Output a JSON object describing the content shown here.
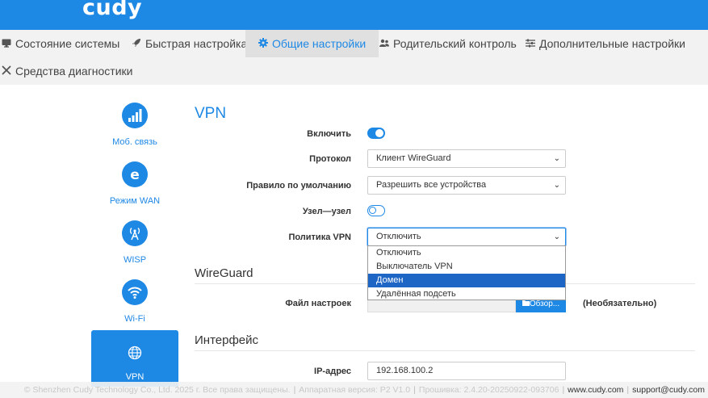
{
  "brand": {
    "logo": "cudy"
  },
  "nav": {
    "tabs": [
      {
        "label": "Состояние системы",
        "icon": "monitor-icon"
      },
      {
        "label": "Быстрая настройка",
        "icon": "rocket-icon"
      },
      {
        "label": "Общие настройки",
        "icon": "gear-icon",
        "active": true
      },
      {
        "label": "Родительский контроль",
        "icon": "users-icon"
      },
      {
        "label": "Дополнительные настройки",
        "icon": "sliders-icon"
      },
      {
        "label": "Средства диагностики",
        "icon": "tools-icon"
      }
    ]
  },
  "sidebar": {
    "items": [
      {
        "label": "Моб. связь",
        "icon": "signal-bars-icon"
      },
      {
        "label": "Режим WAN",
        "icon": "internet-e-icon"
      },
      {
        "label": "WISP",
        "icon": "antenna-icon"
      },
      {
        "label": "Wi-Fi",
        "icon": "wifi-icon"
      },
      {
        "label": "VPN",
        "icon": "globe-icon",
        "active": true
      }
    ]
  },
  "vpn": {
    "title": "VPN",
    "enable_label": "Включить",
    "enable_value": true,
    "protocol_label": "Протокол",
    "protocol_value": "Клиент WireGuard",
    "default_rule_label": "Правило по умолчанию",
    "default_rule_value": "Разрешить все устройства",
    "site_to_site_label": "Узел—узел",
    "site_to_site_value": false,
    "policy_label": "Политика VPN",
    "policy_value": "Отключить",
    "policy_options": [
      "Отключить",
      "Выключатель VPN",
      "Домен",
      "Удалённая подсеть"
    ],
    "policy_highlighted": "Домен"
  },
  "wireguard": {
    "title": "WireGuard",
    "config_file_label": "Файл настроек",
    "browse_label": "Обзор...",
    "optional_note": "(Необязательно)"
  },
  "interface": {
    "title": "Интерфейс",
    "ip_label": "IP-адрес",
    "ip_value": "192.168.100.2"
  },
  "footer": {
    "copyright": "© Shenzhen Cudy Technology Co., Ltd. 2025 г. Все права защищены.",
    "hardware": "Аппаратная версия: P2 V1.0",
    "firmware": "Прошивка: 2.4.20-20250922-093706",
    "website": "www.cudy.com",
    "support": "support@cudy.com"
  },
  "colors": {
    "accent": "#1e88e5",
    "nav_bg": "#f2f2f2",
    "highlight": "#1e66c6"
  }
}
